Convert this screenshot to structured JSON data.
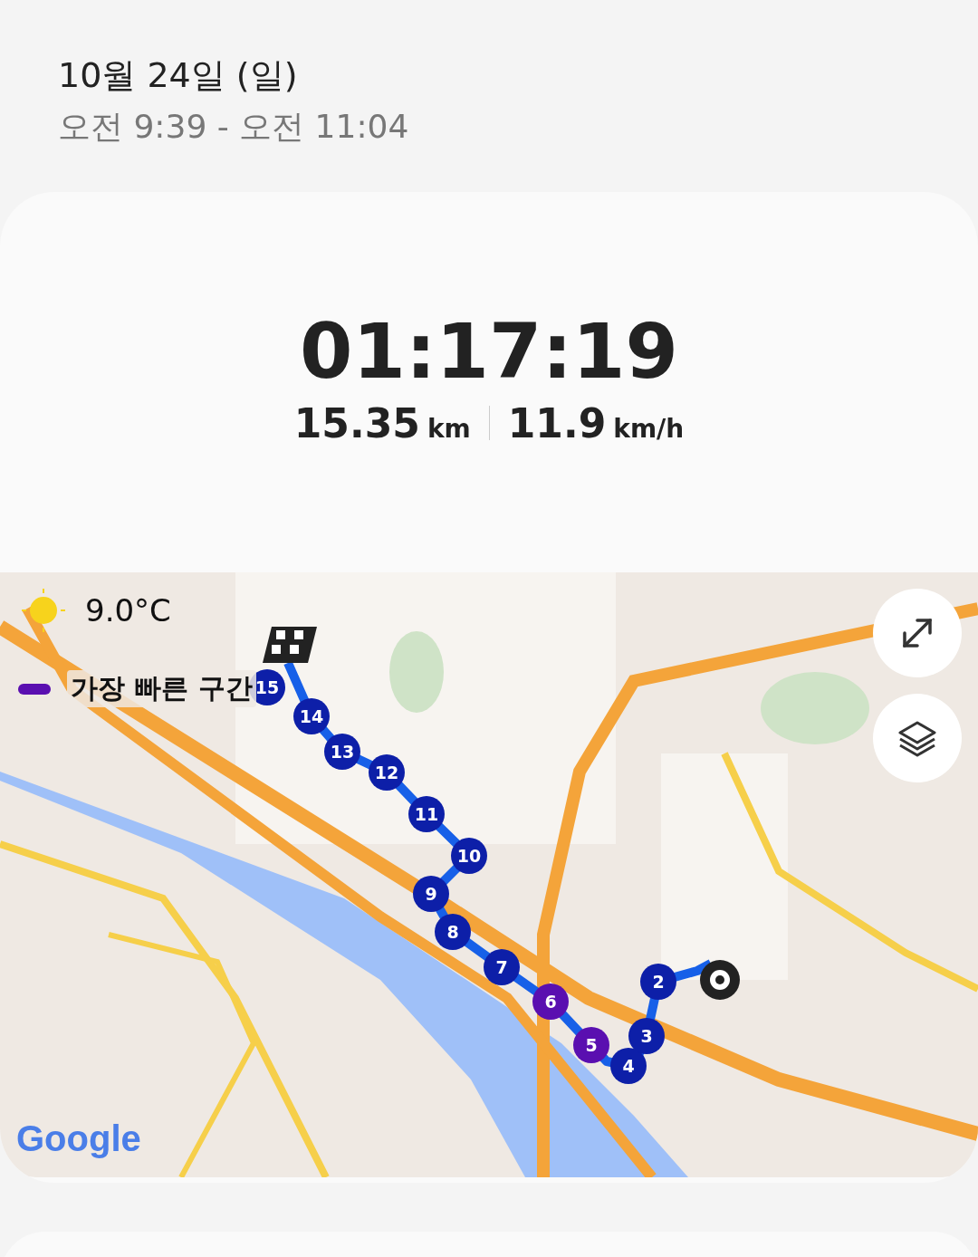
{
  "header": {
    "date": "10월 24일 (일)",
    "time_range": "오전 9:39 - 오전 11:04"
  },
  "summary": {
    "duration": "01:17:19",
    "distance": "15.35",
    "distance_unit": "km",
    "speed": "11.9",
    "speed_unit": "km/h"
  },
  "map": {
    "weather": "9.0°C",
    "legend": {
      "label": "가장 빠른 구간",
      "color": "#5a0fb0"
    },
    "markers": [
      {
        "label": "15",
        "color": "#0d1fa8"
      },
      {
        "label": "14",
        "color": "#0d1fa8"
      },
      {
        "label": "13",
        "color": "#0d1fa8"
      },
      {
        "label": "12",
        "color": "#0d1fa8"
      },
      {
        "label": "11",
        "color": "#0d1fa8"
      },
      {
        "label": "10",
        "color": "#0d1fa8"
      },
      {
        "label": "9",
        "color": "#0d1fa8"
      },
      {
        "label": "8",
        "color": "#0d1fa8"
      },
      {
        "label": "7",
        "color": "#0d1fa8"
      },
      {
        "label": "6",
        "color": "#5a0fb0"
      },
      {
        "label": "5",
        "color": "#5a0fb0"
      },
      {
        "label": "4",
        "color": "#0d1fa8"
      },
      {
        "label": "3",
        "color": "#0d1fa8"
      },
      {
        "label": "2",
        "color": "#0d1fa8"
      }
    ],
    "attribution": "Google"
  }
}
